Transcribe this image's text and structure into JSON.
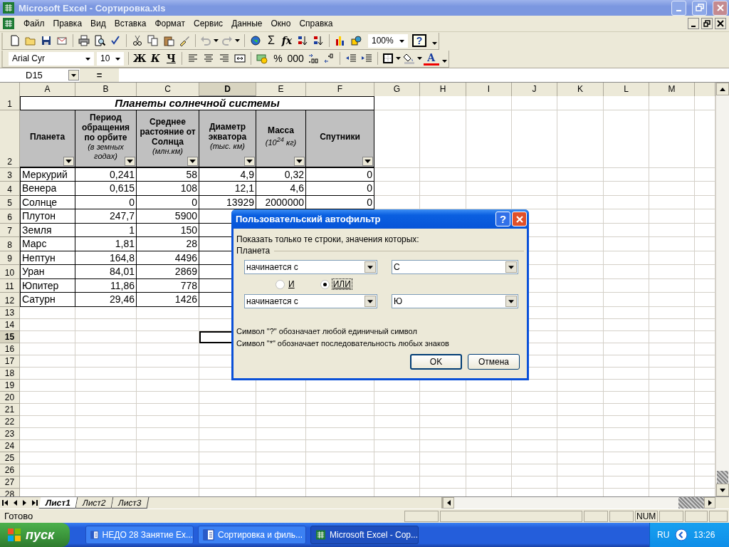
{
  "window": {
    "title": "Microsoft Excel - Сортировка.xls"
  },
  "menu": [
    "Файл",
    "Правка",
    "Вид",
    "Вставка",
    "Формат",
    "Сервис",
    "Данные",
    "Окно",
    "Справка"
  ],
  "standard_toolbar": {
    "sum": "Σ",
    "function": "fx",
    "zoom": "100%",
    "help": "?"
  },
  "formatting_toolbar": {
    "font": "Arial Cyr",
    "size": "10",
    "bold": "Ж",
    "italic": "К",
    "underline": "Ч",
    "percent": "%",
    "thousands": "000",
    "font_color": "A"
  },
  "formula_bar": {
    "name_box": "D15",
    "equals": "="
  },
  "columns": [
    {
      "label": "A",
      "selected": false
    },
    {
      "label": "B",
      "selected": false
    },
    {
      "label": "C",
      "selected": false
    },
    {
      "label": "D",
      "selected": true
    },
    {
      "label": "E",
      "selected": false
    },
    {
      "label": "F",
      "selected": false
    },
    {
      "label": "G",
      "selected": false
    },
    {
      "label": "H",
      "selected": false
    },
    {
      "label": "I",
      "selected": false
    },
    {
      "label": "J",
      "selected": false
    },
    {
      "label": "K",
      "selected": false
    },
    {
      "label": "L",
      "selected": false
    },
    {
      "label": "M",
      "selected": false
    }
  ],
  "rows": [
    {
      "number": "1",
      "kind": "title",
      "selected": false,
      "title": "Планеты солнечной системы"
    },
    {
      "number": "2",
      "kind": "header",
      "selected": false,
      "headers": [
        {
          "text": "Планета"
        },
        {
          "text": "Период обращения по орбите",
          "unit": "(в земных годах)"
        },
        {
          "text": "Среднее растояние от Солнца",
          "unit": "(млн.км)"
        },
        {
          "text": "Диаметр экватора",
          "unit": "(тыс. км)"
        },
        {
          "text": "Масса",
          "unit": "(10$^{24}$ кг)"
        },
        {
          "text": "Спутники"
        }
      ]
    },
    {
      "number": "3",
      "kind": "data",
      "selected": false,
      "cells": [
        "Меркурий",
        "0,241",
        "58",
        "4,9",
        "0,32",
        "0"
      ]
    },
    {
      "number": "4",
      "kind": "data",
      "selected": false,
      "cells": [
        "Венера",
        "0,615",
        "108",
        "12,1",
        "4,6",
        "0"
      ]
    },
    {
      "number": "5",
      "kind": "data",
      "selected": false,
      "cells": [
        "Солнце",
        "0",
        "0",
        "13929",
        "2000000",
        "0"
      ]
    },
    {
      "number": "6",
      "kind": "data",
      "selected": false,
      "cells": [
        "Плутон",
        "247,7",
        "5900"
      ]
    },
    {
      "number": "7",
      "kind": "data",
      "selected": false,
      "cells": [
        "Земля",
        "1",
        "150"
      ]
    },
    {
      "number": "8",
      "kind": "data",
      "selected": false,
      "cells": [
        "Марс",
        "1,81",
        "28"
      ]
    },
    {
      "number": "9",
      "kind": "data",
      "selected": false,
      "cells": [
        "Нептун",
        "164,8",
        "4496"
      ]
    },
    {
      "number": "10",
      "kind": "data",
      "selected": false,
      "cells": [
        "Уран",
        "84,01",
        "2869"
      ]
    },
    {
      "number": "11",
      "kind": "data",
      "selected": false,
      "cells": [
        "Юпитер",
        "11,86",
        "778"
      ]
    },
    {
      "number": "12",
      "kind": "data",
      "selected": false,
      "cells": [
        "Сатурн",
        "29,46",
        "1426"
      ]
    },
    {
      "number": "13",
      "kind": "empty",
      "selected": false
    },
    {
      "number": "14",
      "kind": "empty",
      "selected": false
    },
    {
      "number": "15",
      "kind": "empty",
      "selected": true
    },
    {
      "number": "16",
      "kind": "empty",
      "selected": false
    },
    {
      "number": "17",
      "kind": "empty",
      "selected": false
    },
    {
      "number": "18",
      "kind": "empty",
      "selected": false
    },
    {
      "number": "19",
      "kind": "empty",
      "selected": false
    },
    {
      "number": "20",
      "kind": "empty",
      "selected": false
    },
    {
      "number": "21",
      "kind": "empty",
      "selected": false
    },
    {
      "number": "22",
      "kind": "empty",
      "selected": false
    },
    {
      "number": "23",
      "kind": "empty",
      "selected": false
    },
    {
      "number": "24",
      "kind": "empty",
      "selected": false
    },
    {
      "number": "25",
      "kind": "empty",
      "selected": false
    },
    {
      "number": "26",
      "kind": "empty",
      "selected": false
    },
    {
      "number": "27",
      "kind": "empty",
      "selected": false
    },
    {
      "number": "28",
      "kind": "empty",
      "selected": false
    }
  ],
  "sheet_tabs": [
    {
      "label": "Лист1",
      "selected": true
    },
    {
      "label": "Лист2",
      "selected": false
    },
    {
      "label": "Лист3",
      "selected": false
    }
  ],
  "status_bar": {
    "text": "Готово",
    "indicator": "NUM"
  },
  "dialog": {
    "title": "Пользовательский автофильтр",
    "help": "?",
    "prompt": "Показать только те строки, значения которых:",
    "field": "Планета",
    "conditions": [
      {
        "operator": "начинается с",
        "value": "С"
      },
      {
        "operator": "начинается с",
        "value": "Ю"
      }
    ],
    "logic": [
      {
        "label": "И",
        "selected": false
      },
      {
        "label": "ИЛИ",
        "selected": true
      }
    ],
    "hints": [
      "Символ \"?\" обозначает любой единичный символ",
      "Символ \"*\" обозначает последовательность любых знаков"
    ],
    "buttons": [
      {
        "label": "OK",
        "default": true
      },
      {
        "label": "Отмена",
        "default": false
      }
    ]
  },
  "taskbar": {
    "start": "пуск",
    "tasks": [
      {
        "label": "НЕДО 28 Занятие Ex...",
        "kind": "word",
        "selected": false
      },
      {
        "label": "Сортировка и филь...",
        "kind": "word",
        "selected": false
      },
      {
        "label": "Microsoft Excel - Сор...",
        "kind": "excel",
        "selected": true
      }
    ],
    "language": "RU",
    "clock": "13:26"
  }
}
